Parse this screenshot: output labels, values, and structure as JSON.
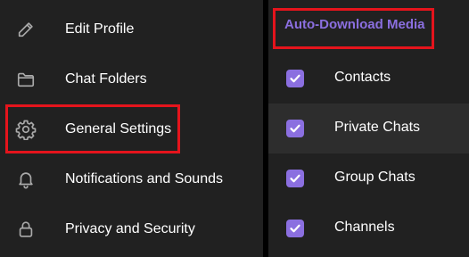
{
  "settings_menu": {
    "items": [
      {
        "label": "Edit Profile",
        "icon": "pencil-icon"
      },
      {
        "label": "Chat Folders",
        "icon": "folder-icon"
      },
      {
        "label": "General Settings",
        "icon": "gear-icon"
      },
      {
        "label": "Notifications and Sounds",
        "icon": "bell-icon"
      },
      {
        "label": "Privacy and Security",
        "icon": "lock-icon"
      }
    ]
  },
  "auto_download": {
    "title": "Auto-Download Media",
    "options": [
      {
        "label": "Contacts",
        "checked": true
      },
      {
        "label": "Private Chats",
        "checked": true
      },
      {
        "label": "Group Chats",
        "checked": true
      },
      {
        "label": "Channels",
        "checked": true
      }
    ]
  },
  "colors": {
    "background": "#212121",
    "accent": "#8b6fe0",
    "highlight_box": "#e5141c",
    "text": "#ffffff"
  }
}
